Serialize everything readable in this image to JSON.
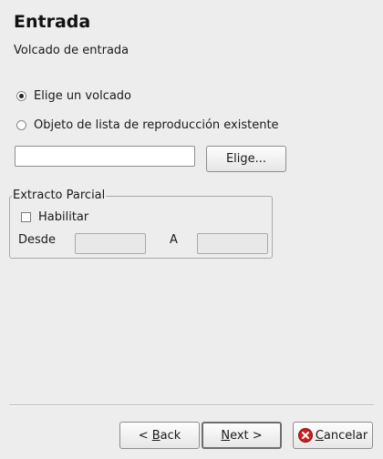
{
  "page": {
    "title": "Entrada",
    "subtitle": "Volcado de entrada"
  },
  "source": {
    "radio_dump_label": "Elige un volcado",
    "radio_dump_checked": true,
    "radio_playlist_label": "Objeto de lista de reproducción existente",
    "radio_playlist_checked": false,
    "path_value": "",
    "choose_button_label": "Elige..."
  },
  "partial": {
    "legend": "Extracto Parcial",
    "enable_label": "Habilitar",
    "enable_checked": false,
    "from_label": "Desde",
    "from_value": "",
    "to_label": "A",
    "to_value": ""
  },
  "buttons": {
    "back_prefix": "< ",
    "back_mnemonic": "B",
    "back_rest": "ack",
    "next_mnemonic": "N",
    "next_rest": "ext >",
    "cancel_mnemonic": "C",
    "cancel_rest": "ancelar",
    "cancel_icon": "cancel-icon",
    "cancel_icon_color": "#cc1f1f"
  }
}
